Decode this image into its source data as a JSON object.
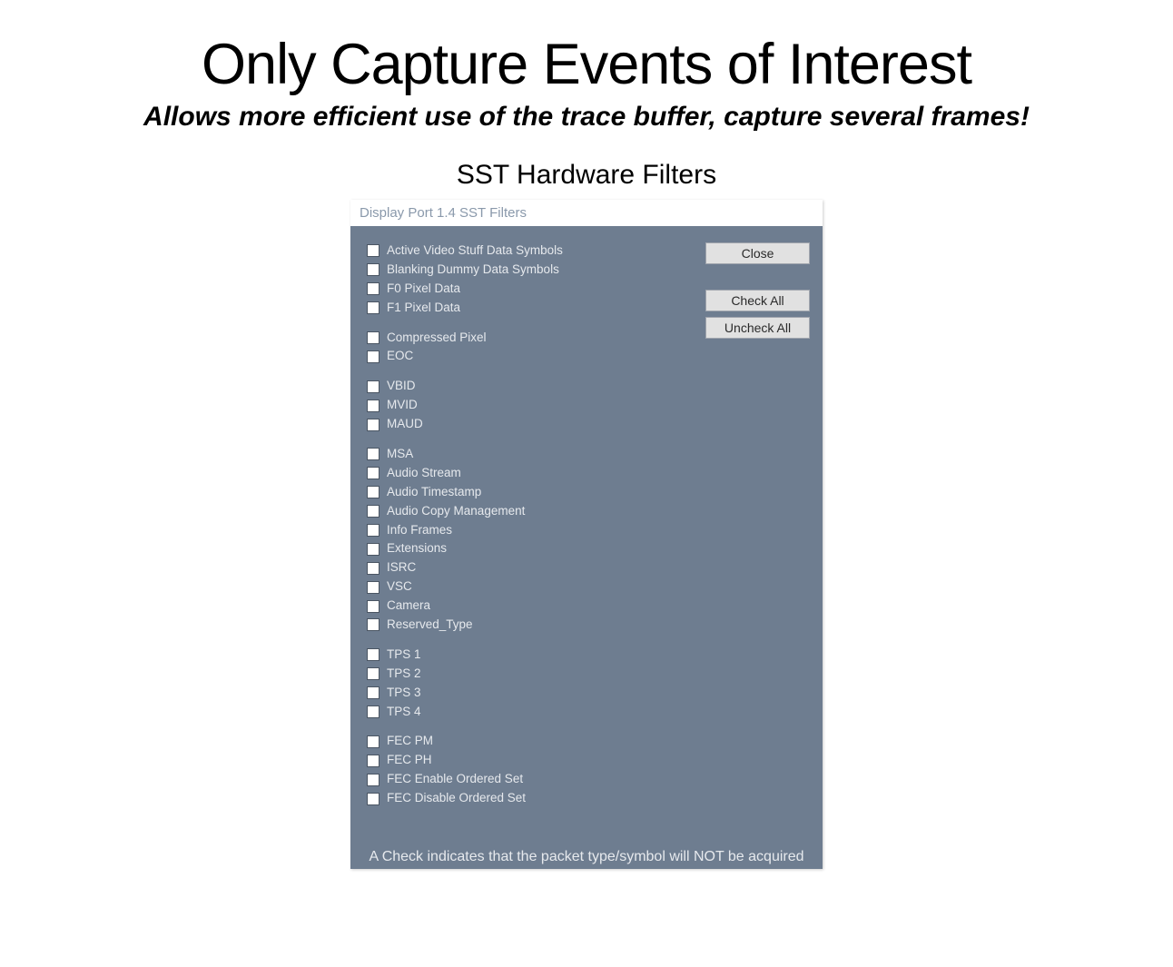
{
  "page": {
    "title": "Only Capture Events of Interest",
    "subtitle": "Allows more efficient use of the trace buffer, capture several frames!",
    "section_header": "SST Hardware Filters"
  },
  "dialog": {
    "title": "Display Port 1.4 SST Filters",
    "buttons": {
      "close": "Close",
      "check_all": "Check All",
      "uncheck_all": "Uncheck All"
    },
    "footer_note": "A Check indicates that the packet type/symbol will NOT be acquired",
    "groups": [
      {
        "items": [
          {
            "label": "Active Video Stuff Data Symbols",
            "checked": false
          },
          {
            "label": "Blanking Dummy Data Symbols",
            "checked": false
          },
          {
            "label": "F0 Pixel Data",
            "checked": false
          },
          {
            "label": "F1 Pixel Data",
            "checked": false
          }
        ]
      },
      {
        "items": [
          {
            "label": "Compressed Pixel",
            "checked": false
          },
          {
            "label": "EOC",
            "checked": false
          }
        ]
      },
      {
        "items": [
          {
            "label": "VBID",
            "checked": false
          },
          {
            "label": "MVID",
            "checked": false
          },
          {
            "label": "MAUD",
            "checked": false
          }
        ]
      },
      {
        "items": [
          {
            "label": "MSA",
            "checked": false
          },
          {
            "label": "Audio Stream",
            "checked": false
          },
          {
            "label": "Audio Timestamp",
            "checked": false
          },
          {
            "label": "Audio Copy Management",
            "checked": false
          },
          {
            "label": "Info Frames",
            "checked": false
          },
          {
            "label": "Extensions",
            "checked": false
          },
          {
            "label": "ISRC",
            "checked": false
          },
          {
            "label": "VSC",
            "checked": false
          },
          {
            "label": "Camera",
            "checked": false
          },
          {
            "label": "Reserved_Type",
            "checked": false
          }
        ]
      },
      {
        "items": [
          {
            "label": "TPS 1",
            "checked": false
          },
          {
            "label": "TPS 2",
            "checked": false
          },
          {
            "label": "TPS 3",
            "checked": false
          },
          {
            "label": "TPS 4",
            "checked": false
          }
        ]
      },
      {
        "items": [
          {
            "label": "FEC PM",
            "checked": false
          },
          {
            "label": "FEC PH",
            "checked": false
          },
          {
            "label": "FEC Enable Ordered Set",
            "checked": false
          },
          {
            "label": "FEC Disable Ordered Set",
            "checked": false
          }
        ]
      }
    ]
  }
}
